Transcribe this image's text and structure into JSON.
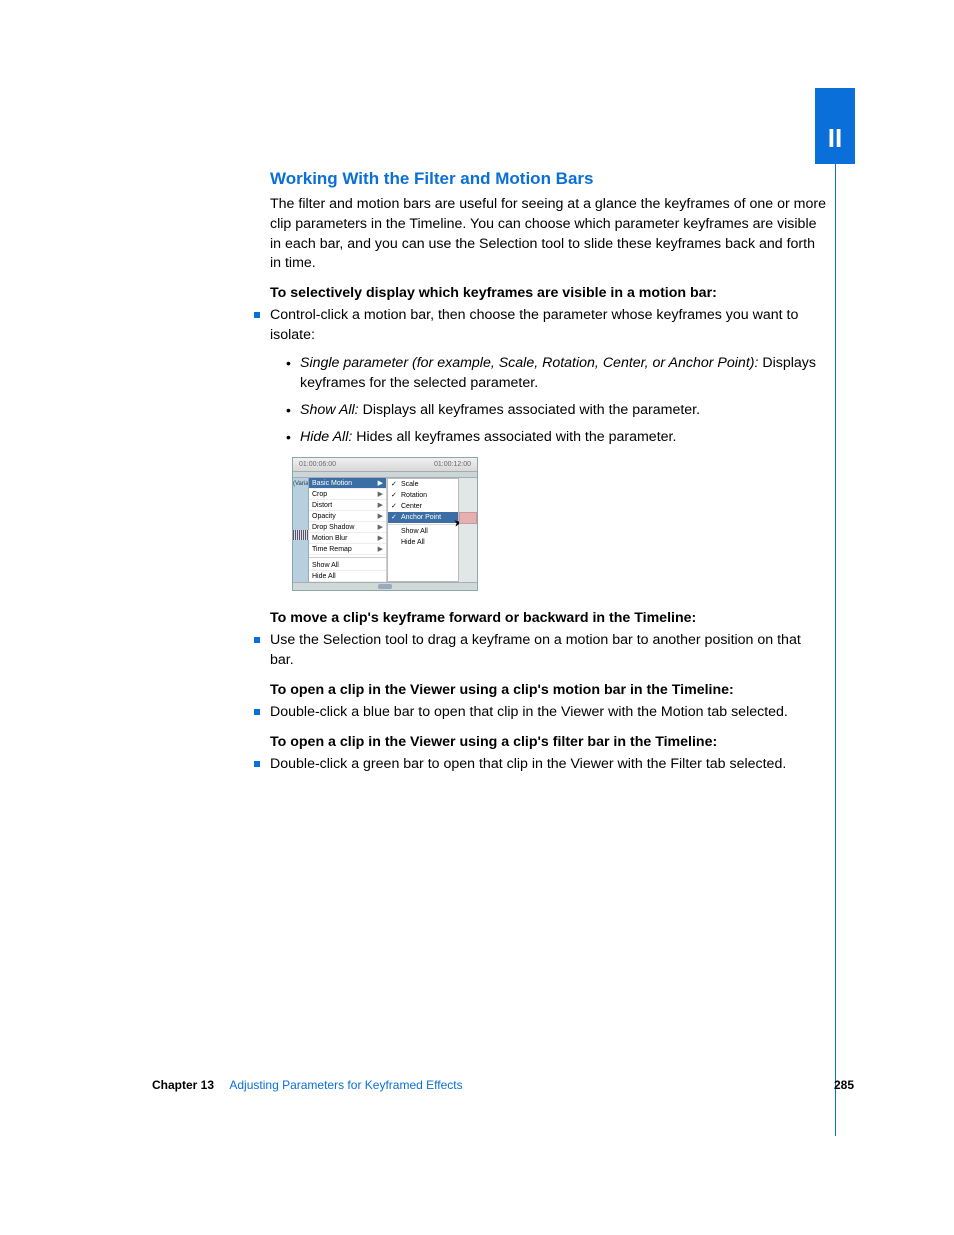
{
  "tab": "II",
  "heading": "Working With the Filter and Motion Bars",
  "intro": "The filter and motion bars are useful for seeing at a glance the keyframes of one or more clip parameters in the Timeline. You can choose which parameter keyframes are visible in each bar, and you can use the Selection tool to slide these keyframes back and forth in time.",
  "task1_heading": "To selectively display which keyframes are visible in a motion bar:",
  "task1_step": "Control-click a motion bar, then choose the parameter whose keyframes you want to isolate:",
  "sub_items": [
    {
      "term": "Single parameter (for example, Scale, Rotation, Center, or Anchor Point):",
      "desc": "  Displays keyframes for the selected parameter."
    },
    {
      "term": "Show All:",
      "desc": "  Displays all keyframes associated with the parameter."
    },
    {
      "term": "Hide All:",
      "desc": "  Hides all keyframes associated with the parameter."
    }
  ],
  "figure": {
    "tc1": "01:00:06:00",
    "tc2": "01:00:12:00",
    "track_label": "(Varia",
    "menu1": [
      "Basic Motion",
      "Crop",
      "Distort",
      "Opacity",
      "Drop Shadow",
      "Motion Blur",
      "Time Remap"
    ],
    "menu1_bottom": [
      "Show All",
      "Hide All"
    ],
    "menu2_checked": [
      "Scale",
      "Rotation",
      "Center",
      "Anchor Point"
    ],
    "menu2_bottom": [
      "Show All",
      "Hide All"
    ]
  },
  "task2_heading": "To move a clip's keyframe forward or backward in the Timeline:",
  "task2_step": "Use the Selection tool to drag a keyframe on a motion bar to another position on that bar.",
  "task3_heading": "To open a clip in the Viewer using a clip's motion bar in the Timeline:",
  "task3_step": "Double-click a blue bar to open that clip in the Viewer with the Motion tab selected.",
  "task4_heading": "To open a clip in the Viewer using a clip's filter bar in the Timeline:",
  "task4_step": "Double-click a green bar to open that clip in the Viewer with the Filter tab selected.",
  "footer": {
    "chapter": "Chapter 13",
    "title": "Adjusting Parameters for Keyframed Effects",
    "page": "285"
  }
}
